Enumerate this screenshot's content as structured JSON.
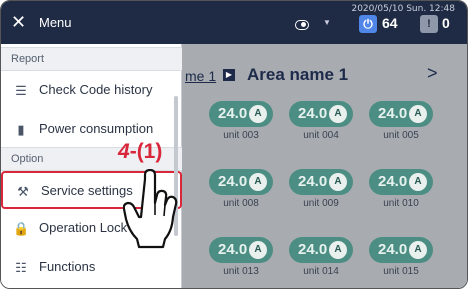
{
  "topbar": {
    "datetime": "2020/05/10 Sun. 12:48",
    "power_count": "64",
    "alert_count": "0",
    "power_icon": "power-icon",
    "alert_icon": "alert-icon"
  },
  "menu": {
    "title": "Menu",
    "sections": [
      {
        "label": "Report"
      },
      {
        "label": "Option"
      }
    ],
    "items": [
      {
        "label": "Check Code history",
        "icon": "list-alert-icon"
      },
      {
        "label": "Power consumption",
        "icon": "bar-chart-icon"
      },
      {
        "label": "Service settings",
        "icon": "tool-icon",
        "selected": true
      },
      {
        "label": "Operation Lock",
        "icon": "lock-icon"
      },
      {
        "label": "Functions",
        "icon": "functions-icon"
      }
    ]
  },
  "main": {
    "breadcrumb_link": "me 1",
    "area_name": "Area name 1"
  },
  "units": [
    {
      "temp": "24.0",
      "label": "unit 003"
    },
    {
      "temp": "24.0",
      "label": "unit 004"
    },
    {
      "temp": "24.0",
      "label": "unit 005"
    },
    {
      "temp": "24.0",
      "label": "unit 008"
    },
    {
      "temp": "24.0",
      "label": "unit 009"
    },
    {
      "temp": "24.0",
      "label": "unit 010"
    },
    {
      "temp": "24.0",
      "label": "unit 013"
    },
    {
      "temp": "24.0",
      "label": "unit 014"
    },
    {
      "temp": "24.0",
      "label": "unit 015"
    }
  ],
  "annotation": {
    "step": "4",
    "sub": "(1)"
  },
  "colors": {
    "header": "#1f2b44",
    "highlight": "#d8263a",
    "unit": "#4d8e84"
  }
}
